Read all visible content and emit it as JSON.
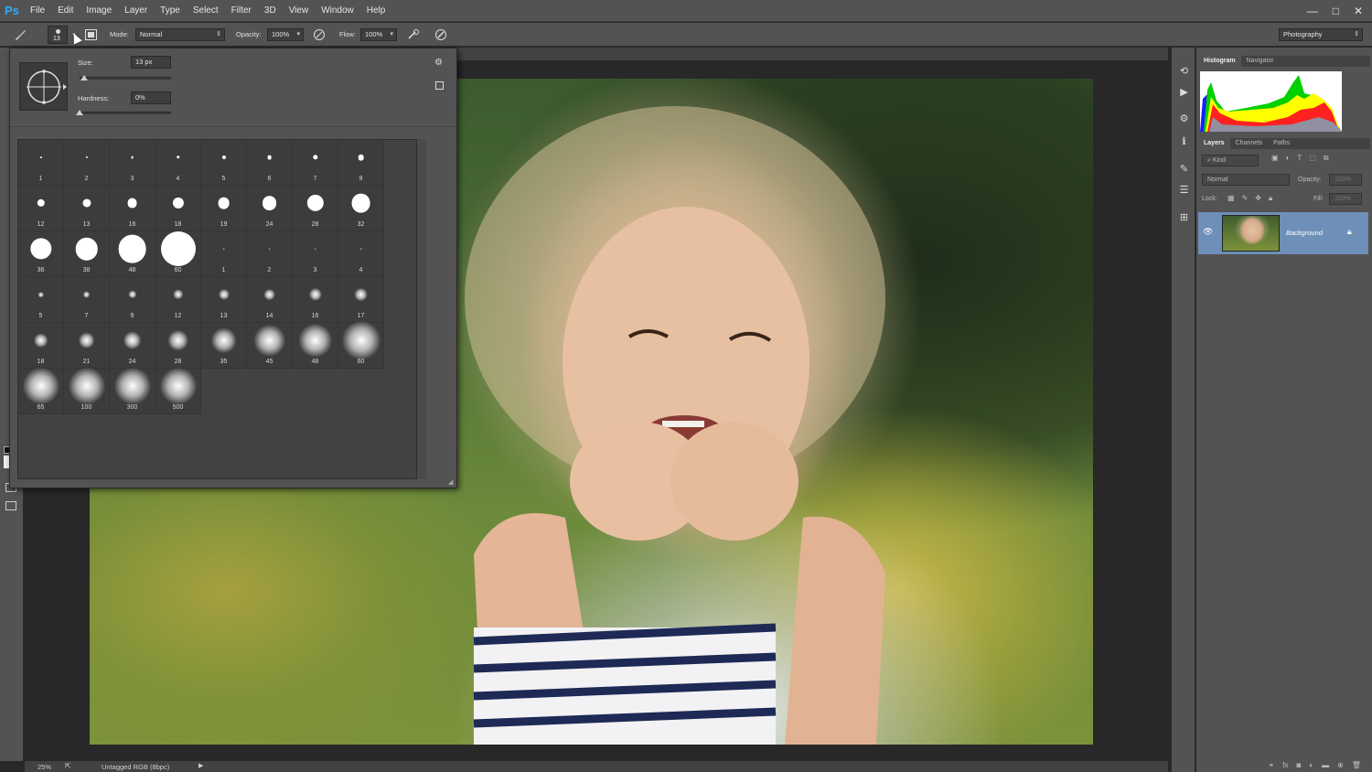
{
  "app": {
    "logo": "Ps"
  },
  "menu": [
    "File",
    "Edit",
    "Image",
    "Layer",
    "Type",
    "Select",
    "Filter",
    "3D",
    "View",
    "Window",
    "Help"
  ],
  "window_controls": [
    "—",
    "□",
    "✕"
  ],
  "options_bar": {
    "brush_size": "13",
    "mode_label": "Mode:",
    "mode_value": "Normal",
    "opacity_label": "Opacity:",
    "opacity_value": "100%",
    "flow_label": "Flow:",
    "flow_value": "100%",
    "workspace": "Photography"
  },
  "brush_picker": {
    "size_label": "Size:",
    "size_value": "13 px",
    "hardness_label": "Hardness:",
    "hardness_value": "0%",
    "size_slider_fraction": 0.05,
    "hardness_slider_fraction": 0.0,
    "presets": [
      "1",
      "2",
      "3",
      "4",
      "5",
      "6",
      "7",
      "9",
      "12",
      "13",
      "16",
      "18",
      "19",
      "24",
      "28",
      "32",
      "36",
      "38",
      "48",
      "60",
      "1",
      "2",
      "3",
      "4",
      "5",
      "7",
      "9",
      "12",
      "13",
      "14",
      "16",
      "17",
      "18",
      "21",
      "24",
      "28",
      "35",
      "45",
      "48",
      "60",
      "65",
      "100",
      "300",
      "500"
    ]
  },
  "status_bar": {
    "zoom": "25%",
    "doc_info": "Untagged RGB (8bpc)"
  },
  "panels": {
    "histogram_tabs": [
      "Histogram",
      "Navigator"
    ],
    "layers_tabs": [
      "Layers",
      "Channels",
      "Paths"
    ],
    "filter_kind": "Kind",
    "blend_mode": "Normal",
    "opacity_label": "Opacity:",
    "opacity_value": "100%",
    "lock_label": "Lock:",
    "fill_label": "Fill:",
    "fill_value": "100%",
    "layer_name": "Background"
  },
  "colors": {
    "ui_bg": "#535353",
    "canvas_bg": "#282828",
    "selected_layer": "#6e8fb7",
    "ps_blue": "#31a8ff"
  }
}
